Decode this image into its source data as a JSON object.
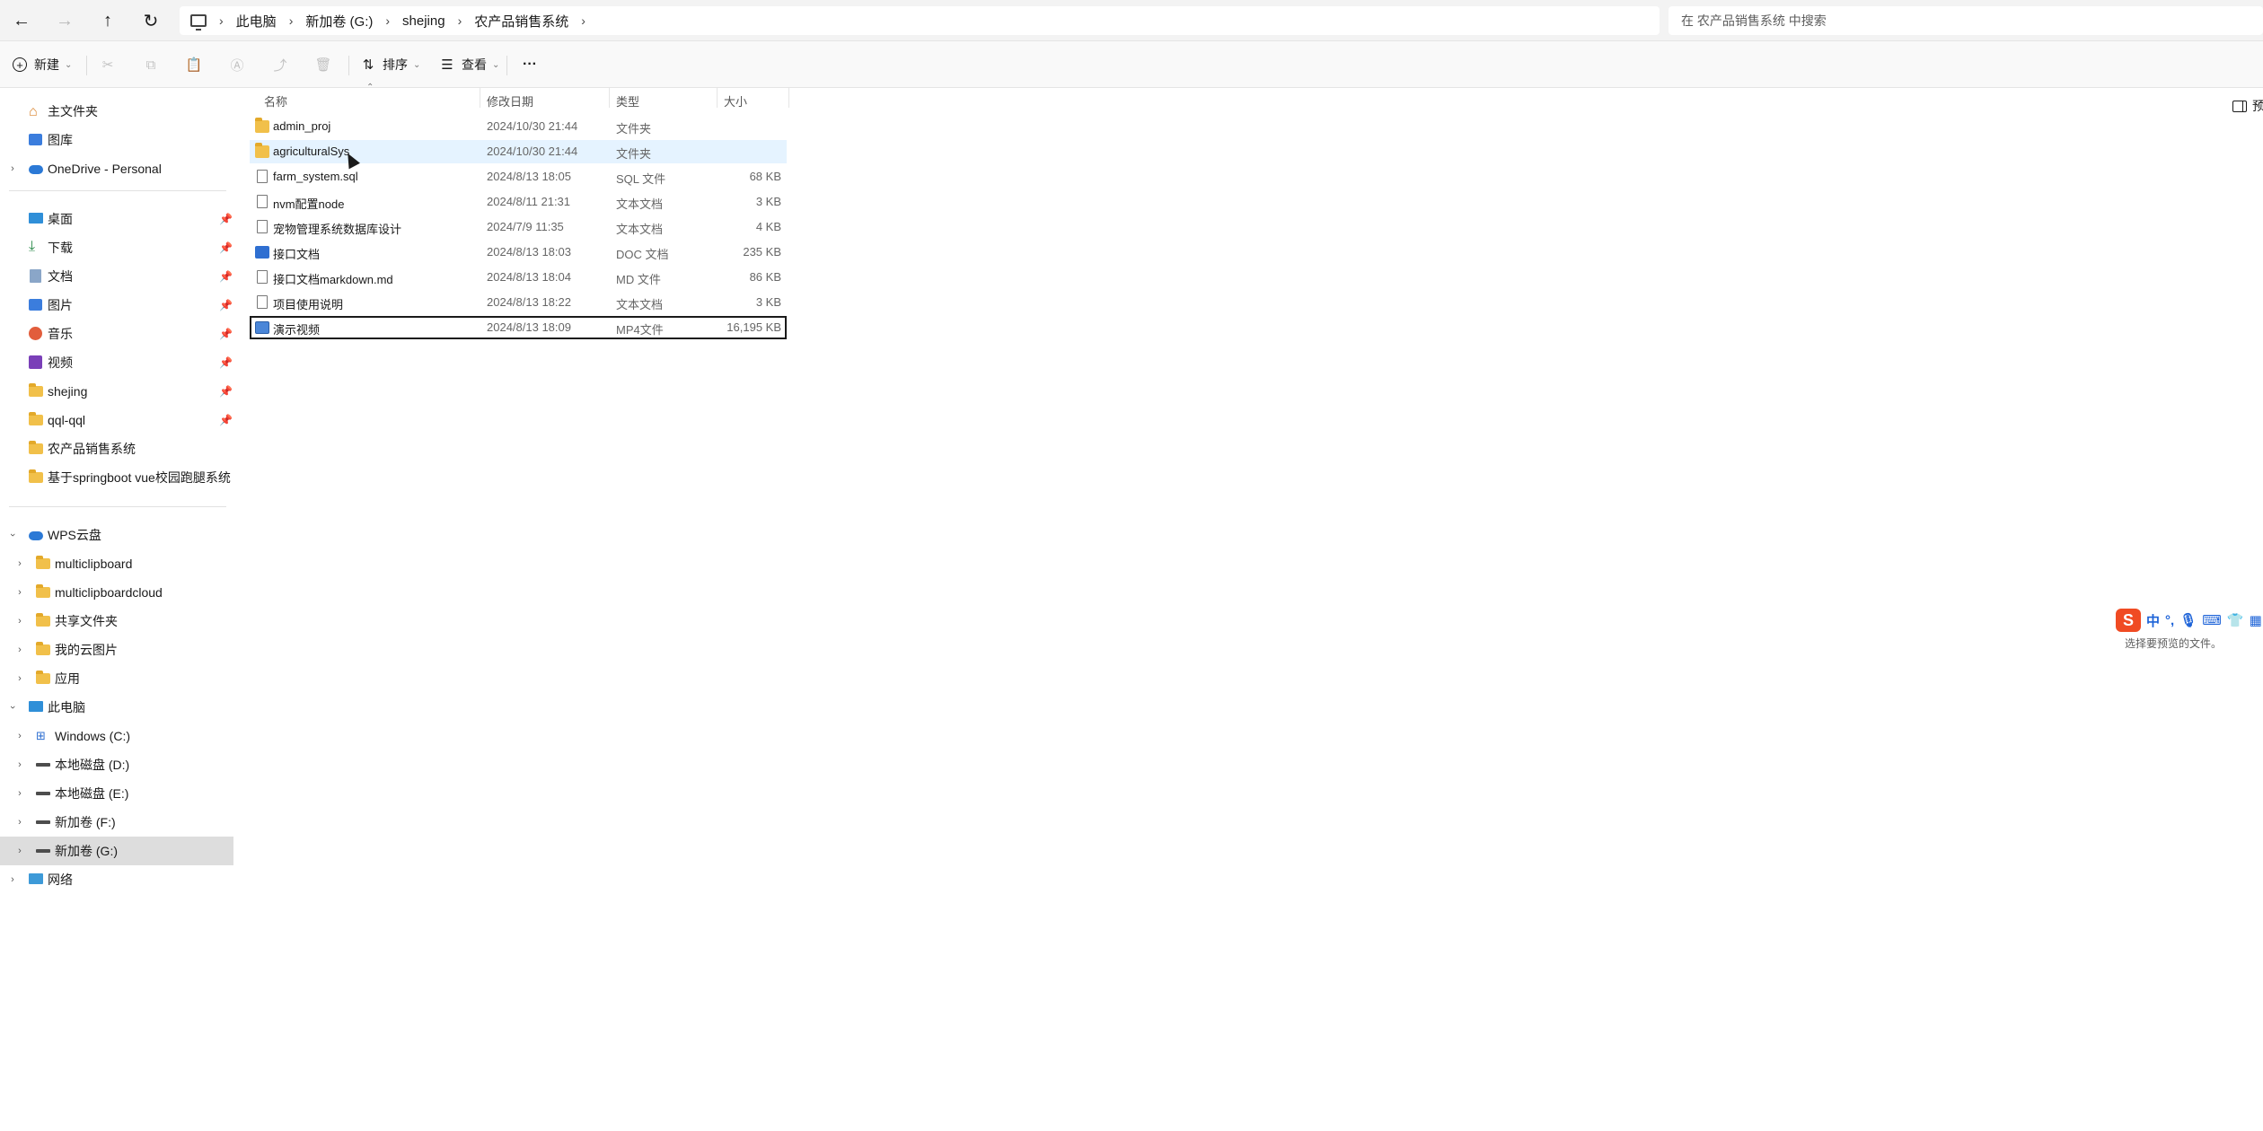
{
  "nav": {
    "back": "←",
    "forward": "→",
    "up": "↑",
    "refresh": "↻"
  },
  "breadcrumb": [
    "此电脑",
    "新加卷 (G:)",
    "shejing",
    "农产品销售系统"
  ],
  "search": {
    "placeholder": "在 农产品销售系统 中搜索"
  },
  "toolbar": {
    "new_label": "新建",
    "sort_label": "排序",
    "view_label": "查看",
    "more_label": "···",
    "pane_label": "预"
  },
  "sidebar": {
    "quick": [
      {
        "label": "主文件夹",
        "icon": "home-icon"
      },
      {
        "label": "图库",
        "icon": "gallery-icon"
      },
      {
        "label": "OneDrive - Personal",
        "icon": "cloud-icon"
      }
    ],
    "pinned": [
      {
        "label": "桌面",
        "icon": "desktop-icon"
      },
      {
        "label": "下载",
        "icon": "download-icon"
      },
      {
        "label": "文档",
        "icon": "documents-icon"
      },
      {
        "label": "图片",
        "icon": "pictures-icon"
      },
      {
        "label": "音乐",
        "icon": "music-icon"
      },
      {
        "label": "视频",
        "icon": "videos-icon"
      },
      {
        "label": "shejing",
        "icon": "folder-icon"
      },
      {
        "label": "qql-qql",
        "icon": "folder-icon"
      },
      {
        "label": "农产品销售系统",
        "icon": "folder-icon"
      },
      {
        "label": "基于springboot vue校园跑腿系统",
        "icon": "folder-icon"
      }
    ],
    "wps": {
      "label": "WPS云盘",
      "children": [
        "multiclipboard",
        "multiclipboardcloud",
        "共享文件夹",
        "我的云图片",
        "应用"
      ]
    },
    "pc": {
      "label": "此电脑",
      "children": [
        "Windows (C:)",
        "本地磁盘 (D:)",
        "本地磁盘 (E:)",
        "新加卷 (F:)",
        "新加卷 (G:)"
      ]
    },
    "network": "网络"
  },
  "columns": {
    "name": "名称",
    "date": "修改日期",
    "type": "类型",
    "size": "大小"
  },
  "files": [
    {
      "name": "admin_proj",
      "date": "2024/10/30 21:44",
      "type": "文件夹",
      "size": "",
      "icon": "folder-icon"
    },
    {
      "name": "agriculturalSys",
      "date": "2024/10/30 21:44",
      "type": "文件夹",
      "size": "",
      "icon": "folder-icon"
    },
    {
      "name": "farm_system.sql",
      "date": "2024/8/13 18:05",
      "type": "SQL 文件",
      "size": "68 KB",
      "icon": "file-icon"
    },
    {
      "name": "nvm配置node",
      "date": "2024/8/11 21:31",
      "type": "文本文档",
      "size": "3 KB",
      "icon": "text-file-icon"
    },
    {
      "name": "宠物管理系统数据库设计",
      "date": "2024/7/9 11:35",
      "type": "文本文档",
      "size": "4 KB",
      "icon": "text-file-icon"
    },
    {
      "name": "接口文档",
      "date": "2024/8/13 18:03",
      "type": "DOC 文档",
      "size": "235 KB",
      "icon": "word-doc-icon"
    },
    {
      "name": "接口文档markdown.md",
      "date": "2024/8/13 18:04",
      "type": "MD 文件",
      "size": "86 KB",
      "icon": "file-icon"
    },
    {
      "name": "项目使用说明",
      "date": "2024/8/13 18:22",
      "type": "文本文档",
      "size": "3 KB",
      "icon": "text-file-icon"
    },
    {
      "name": "演示视频",
      "date": "2024/8/13 18:09",
      "type": "MP4文件",
      "size": "16,195 KB",
      "icon": "video-file-icon"
    }
  ],
  "preview": {
    "empty_text": "选择要预览的文件。"
  },
  "ime": {
    "logo": "S",
    "mode": "中",
    "punct": "°,"
  }
}
